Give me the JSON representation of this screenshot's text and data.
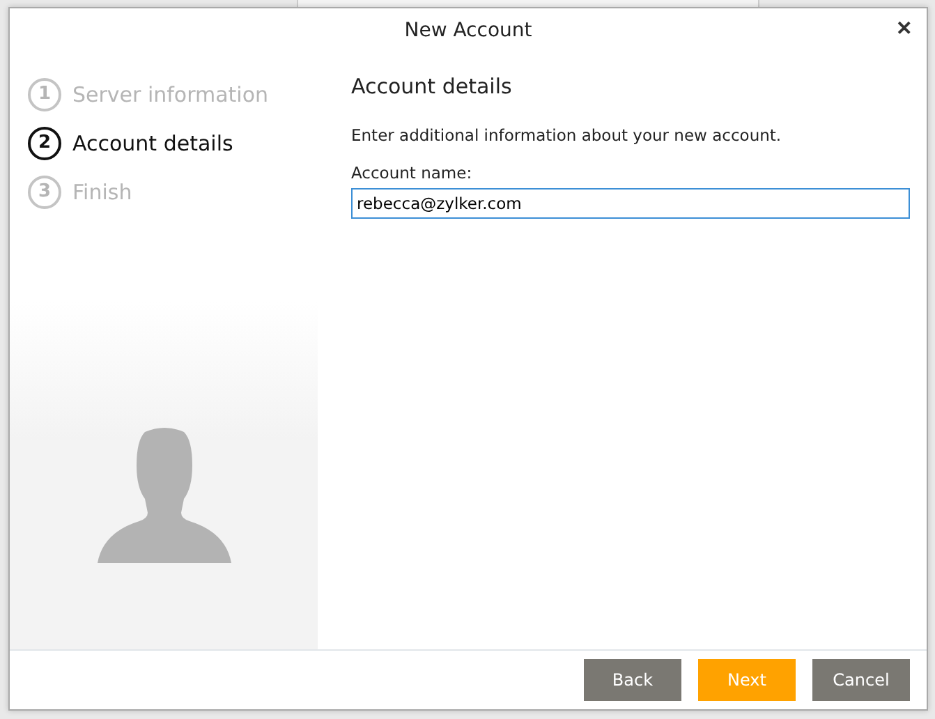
{
  "window": {
    "title": "New Account",
    "close": "✕"
  },
  "steps": [
    {
      "number": "1",
      "label": "Server information",
      "selected": false
    },
    {
      "number": "2",
      "label": "Account details",
      "selected": true
    },
    {
      "number": "3",
      "label": "Finish",
      "selected": false
    }
  ],
  "content": {
    "heading": "Account details",
    "description": "Enter additional information about your new account.",
    "field_label": "Account name:",
    "field_value": "rebecca@zylker.com"
  },
  "buttons": [
    {
      "label": "Back",
      "kind": "secondary"
    },
    {
      "label": "Next",
      "kind": "primary"
    },
    {
      "label": "Cancel",
      "kind": "secondary"
    }
  ]
}
